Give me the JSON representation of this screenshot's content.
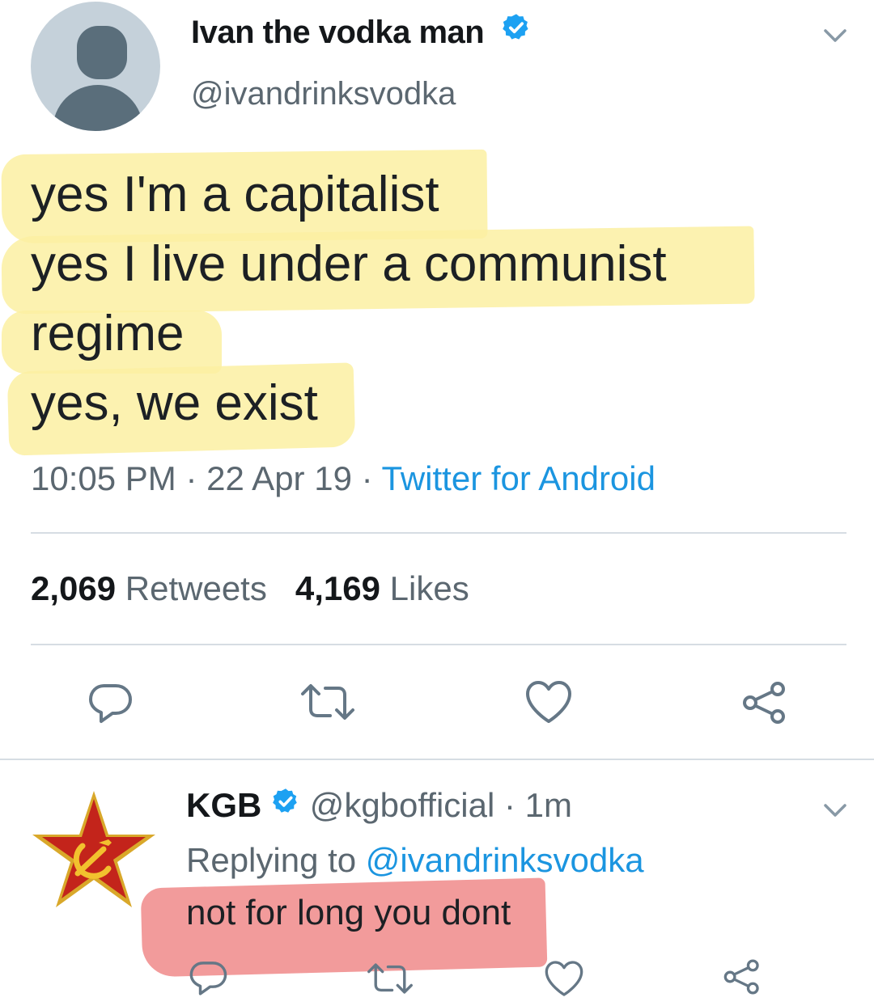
{
  "tweet": {
    "display_name": "Ivan the vodka man",
    "handle": "@ivandrinksvodka",
    "lines": [
      "yes I'm a capitalist",
      "yes I live under a communist",
      "regime",
      "yes, we exist"
    ],
    "time": "10:05 PM",
    "sep1": " · ",
    "date": "22 Apr 19",
    "sep2": " · ",
    "source": "Twitter for Android",
    "retweets_count": "2,069",
    "retweets_label": " Retweets",
    "likes_count": "4,169",
    "likes_label": " Likes",
    "highlight_color": "#fbf0a2",
    "source_color": "#1b95e0"
  },
  "icons": {
    "verified": "verified-badge-icon",
    "chevron": "chevron-down-icon",
    "reply": "reply-icon",
    "retweet": "retweet-icon",
    "like": "heart-icon",
    "share": "share-icon",
    "avatar_kgb": "soviet-star-icon"
  },
  "reply": {
    "display_name": "KGB",
    "handle": "@kgbofficial",
    "sep": " · ",
    "time": "1m",
    "replying_label": "Replying to ",
    "replying_handle": "@ivandrinksvodka",
    "text": "not for long you dont",
    "highlight_color": "#f08a8a"
  }
}
